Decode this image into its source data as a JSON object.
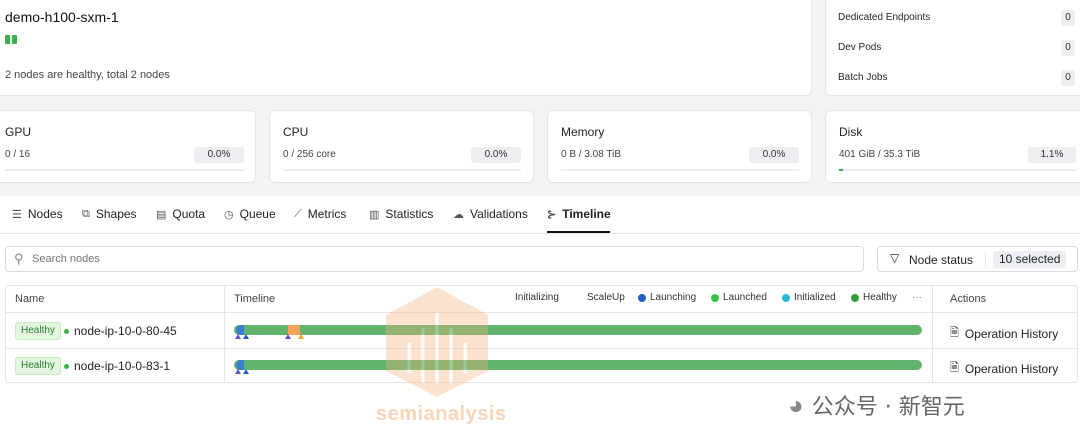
{
  "cluster": {
    "name": "demo-h100-sxm-1",
    "health_text": "2 nodes are healthy, total 2 nodes"
  },
  "summary": {
    "dedicated_label": "Dedicated Endpoints",
    "dedicated_count": "0",
    "devpods_label": "Dev Pods",
    "devpods_count": "0",
    "batch_label": "Batch Jobs",
    "batch_count": "0"
  },
  "resources": {
    "gpu": {
      "label": "GPU",
      "value": "0 / 16",
      "percent": "0.0%"
    },
    "cpu": {
      "label": "CPU",
      "value": "0 / 256 core",
      "percent": "0.0%"
    },
    "memory": {
      "label": "Memory",
      "value": "0 B / 3.08 TiB",
      "percent": "0.0%"
    },
    "disk": {
      "label": "Disk",
      "value": "401 GiB / 35.3 TiB",
      "percent": "1.1%",
      "fill_fraction": 0.011
    }
  },
  "tabs": {
    "nodes": "Nodes",
    "shapes": "Shapes",
    "quota": "Quota",
    "queue": "Queue",
    "metrics": "Metrics",
    "statistics": "Statistics",
    "validations": "Validations",
    "timeline": "Timeline",
    "active": "Timeline"
  },
  "toolbar": {
    "search_placeholder": "Search nodes",
    "filter_label": "Node status",
    "filter_selected": "10 selected"
  },
  "table": {
    "col_name": "Name",
    "col_timeline": "Timeline",
    "col_actions": "Actions",
    "legend": {
      "initializing": "Initializing",
      "scaleup": "ScaleUp",
      "launching": "Launching",
      "launched": "Launched",
      "initialized": "Initialized",
      "healthy": "Healthy",
      "more": "···"
    },
    "rows": [
      {
        "status": "Healthy",
        "node": "node-ip-10-0-80-45",
        "action": "Operation History"
      },
      {
        "status": "Healthy",
        "node": "node-ip-10-0-83-1",
        "action": "Operation History"
      }
    ]
  },
  "watermark": {
    "brand": "semianalysis",
    "wechat": "公众号 · 新智元"
  },
  "colors": {
    "healthy_green": "#3bb04a",
    "timeline_green": "#62b36b",
    "launching_blue": "#1e5fc4",
    "initialized_cyan": "#2bb7d6",
    "scaleup_orange": "#f5a623"
  }
}
